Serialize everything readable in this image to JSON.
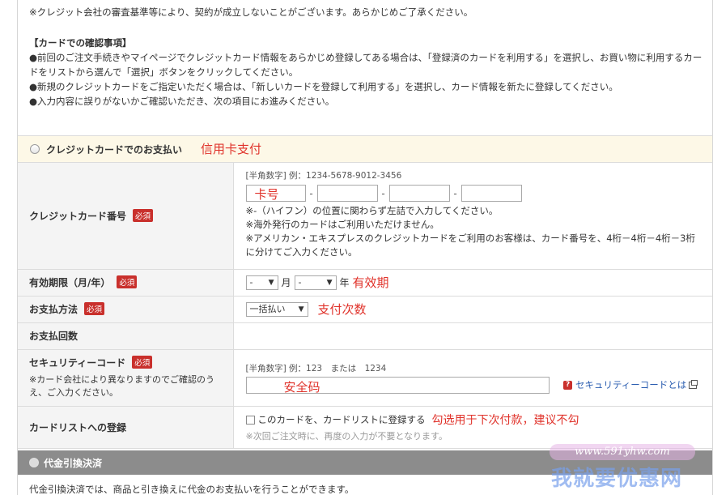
{
  "notice": {
    "line0": "※クレジット会社の審査基準等により、契約が成立しないことがございます。あらかじめご了承ください。",
    "heading": "【カードでの確認事項】",
    "lines": [
      "●前回のご注文手続きやマイページでクレジットカード情報をあらかじめ登録してある場合は、「登録済のカードを利用する」を選択し、お買い物に利用するカードをリストから選んで「選択」ボタンをクリックしてください。",
      "●新規のクレジットカードをご指定いただく場合は、「新しいカードを登録して利用する」を選択し、カード情報を新たに登録してください。",
      "●入力内容に誤りがないかご確認いただき、次の項目にお進みください。"
    ]
  },
  "credit_section": {
    "label": "クレジットカードでのお支払い",
    "annotation": "信用卡支付"
  },
  "required_badge": "必須",
  "card_number": {
    "label": "クレジットカード番号",
    "hint": "[半角数字] 例：1234-5678-9012-3456",
    "dash": "-",
    "annotation": "卡号",
    "notes": [
      "※-（ハイフン）の位置に関わらず左詰で入力してください。",
      "※海外発行のカードはご利用いただけません。",
      "※アメリカン・エキスプレスのクレジットカードをご利用のお客様は、カード番号を、4桁－4桁－4桁－3桁に分けてご入力ください。"
    ]
  },
  "expiry": {
    "label": "有効期限（月/年）",
    "month_value": "-",
    "month_unit": "月",
    "year_value": "-",
    "year_unit": "年",
    "annotation": "有效期"
  },
  "payment_method": {
    "label": "お支払方法",
    "value": "一括払い",
    "annotation": "支付次数"
  },
  "installments": {
    "label": "お支払回数"
  },
  "security_code": {
    "label": "セキュリティーコード",
    "note": "※カード会社により異なりますのでご確認のうえ、ご入力ください。",
    "hint": "[半角数字] 例：123　または　1234",
    "annotation": "安全码",
    "help_icon": "?",
    "link": "セキュリティーコードとは"
  },
  "card_list": {
    "label": "カードリストへの登録",
    "checkbox_label": "このカードを、カードリストに登録する",
    "annotation": "勾选用于下次付款，建议不勾",
    "note": "※次回ご注文時に、再度の入力が不要となります。"
  },
  "cod": {
    "label": "代金引換決済",
    "text": "代金引換決済では、商品と引き換えに代金のお支払いを行うことができます。"
  },
  "watermark": {
    "site": "www.591yhw.com",
    "name": "我就要优惠网"
  },
  "colors": {
    "annotation": "#e0322a",
    "required": "#c9302c",
    "link": "#2a5db0"
  }
}
